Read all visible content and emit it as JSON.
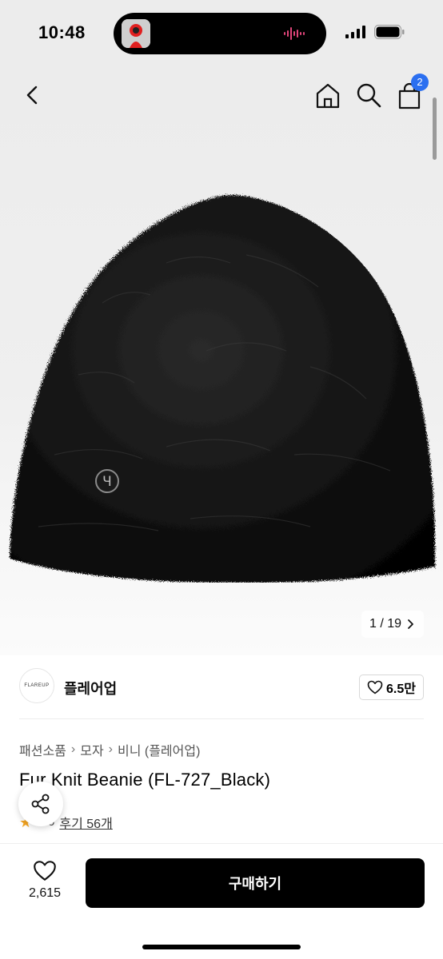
{
  "status_bar": {
    "time": "10:48"
  },
  "header": {
    "cart_count": "2"
  },
  "gallery": {
    "counter": "1 / 19",
    "logo_mark": "Ч"
  },
  "brand": {
    "logo_text": "FLAREUP",
    "name": "플레어업",
    "likes": "6.5만"
  },
  "breadcrumb": [
    "패션소품",
    "모자",
    "비니 (플레어업)"
  ],
  "product": {
    "title": "Fur Knit Beanie (FL-727_Black)",
    "rating": "4.6",
    "reviews": "후기 56개"
  },
  "bottom_bar": {
    "wish_count": "2,615",
    "buy_label": "구매하기"
  },
  "colors": {
    "badge": "#2b6ff0",
    "star": "#f5a623",
    "buy_button": "#000000"
  }
}
